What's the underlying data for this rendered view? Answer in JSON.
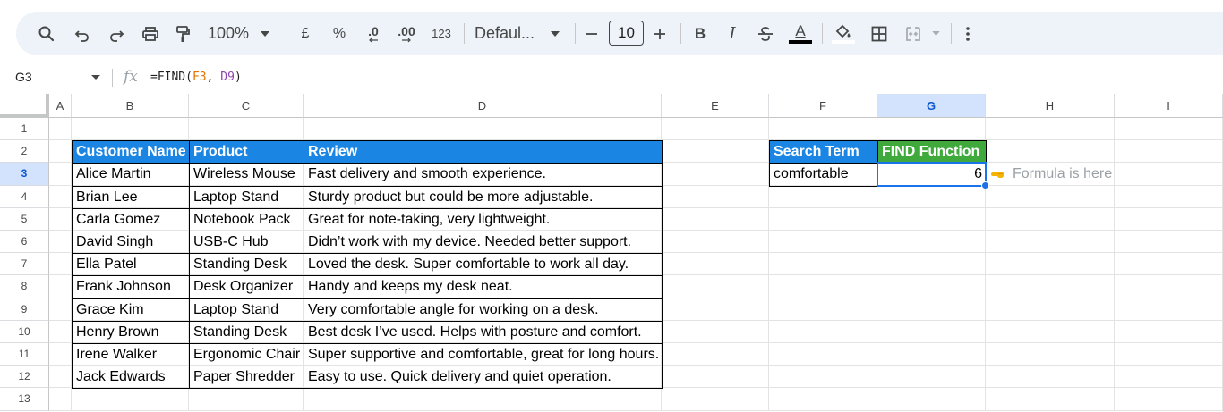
{
  "toolbar": {
    "zoom": "100%",
    "currency": "£",
    "percent": "%",
    "decrease_decimals": ".0",
    "increase_decimals": ".00",
    "number_format": "123",
    "font_name": "Defaul...",
    "font_size": "10",
    "bold": "B",
    "italic": "I",
    "text_color": "A"
  },
  "formula_bar": {
    "name_box": "G3",
    "formula_prefix": "=FIND(",
    "formula_ref1": "F3",
    "formula_sep": ", ",
    "formula_ref2": "D9",
    "formula_suffix": ")"
  },
  "columns": [
    "A",
    "B",
    "C",
    "D",
    "E",
    "F",
    "G",
    "H",
    "I"
  ],
  "rows": [
    "1",
    "2",
    "3",
    "4",
    "5",
    "6",
    "7",
    "8",
    "9",
    "10",
    "11",
    "12",
    "13"
  ],
  "table": {
    "headers": [
      "Customer Name",
      "Product",
      "Review"
    ],
    "rows": [
      [
        "Alice Martin",
        "Wireless Mouse",
        "Fast delivery and smooth experience."
      ],
      [
        "Brian Lee",
        "Laptop Stand",
        "Sturdy product but could be more adjustable."
      ],
      [
        "Carla Gomez",
        "Notebook Pack",
        "Great for note-taking, very lightweight."
      ],
      [
        "David Singh",
        "USB-C Hub",
        "Didn’t work with my device. Needed better support."
      ],
      [
        "Ella Patel",
        "Standing Desk",
        "Loved the desk. Super comfortable to work all day."
      ],
      [
        "Frank Johnson",
        "Desk Organizer",
        "Handy and keeps my desk neat."
      ],
      [
        "Grace Kim",
        "Laptop Stand",
        "Very comfortable angle for working on a desk."
      ],
      [
        "Henry Brown",
        "Standing Desk",
        "Best desk I’ve used. Helps with posture and comfort."
      ],
      [
        "Irene Walker",
        "Ergonomic Chair",
        "Super supportive and comfortable, great for long hours."
      ],
      [
        "Jack Edwards",
        "Paper Shredder",
        "Easy to use. Quick delivery and quiet operation."
      ]
    ]
  },
  "search": {
    "header": "Search Term",
    "value": "comfortable",
    "find_header": "FIND Function",
    "find_result": "6",
    "note": "Formula is here"
  },
  "colors": {
    "header_blue": "#1a85e3",
    "header_green": "#3fa93c",
    "selection": "#1a73e8"
  }
}
